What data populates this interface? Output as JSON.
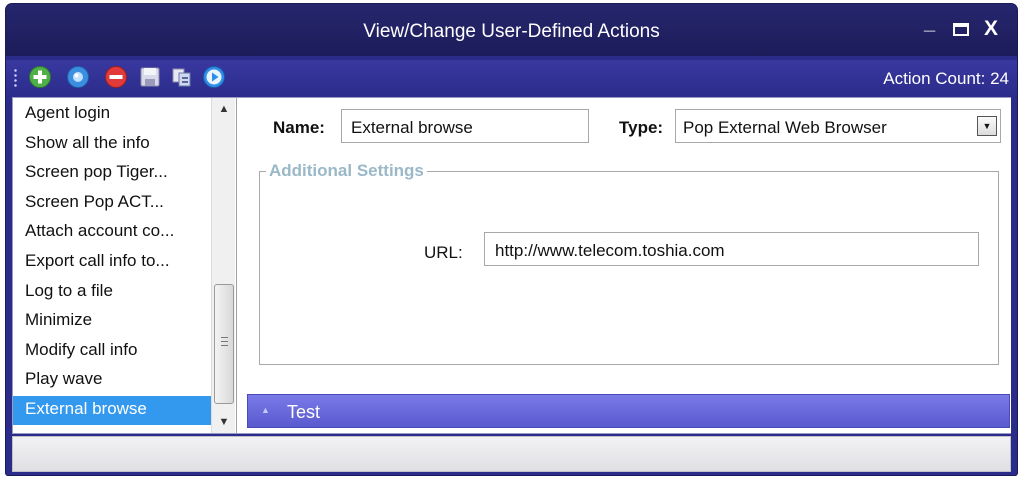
{
  "window": {
    "title": "View/Change User-Defined Actions",
    "minimize_glyph": "_",
    "close_glyph": "X"
  },
  "toolbar": {
    "icons": [
      "add-icon",
      "edit-icon",
      "delete-icon",
      "save-icon",
      "copy-icon",
      "play-icon"
    ],
    "action_count": "Action Count: 24"
  },
  "actions_list": {
    "items": [
      "Agent login",
      "Show all the info",
      "Screen pop Tiger...",
      "Screen Pop ACT...",
      "Attach account co...",
      "Export call info to...",
      "Log to a file",
      "Minimize",
      "Modify call info",
      "Play wave",
      "External browse"
    ],
    "selected_index": 10
  },
  "form": {
    "name_label": "Name:",
    "name_value": "External browse",
    "type_label": "Type:",
    "type_value": "Pop External Web Browser",
    "additional_settings_title": "Additional Settings",
    "url_label": "URL:",
    "url_value": "http://www.telecom.toshia.com"
  },
  "test_bar": {
    "label": "Test"
  },
  "colors": {
    "title_bar": "#1c1c5a",
    "toolbar": "#2c2c8c",
    "selected_item": "#3399ee",
    "test_bar": "#5a5acf",
    "group_title": "#9ab8c8"
  }
}
